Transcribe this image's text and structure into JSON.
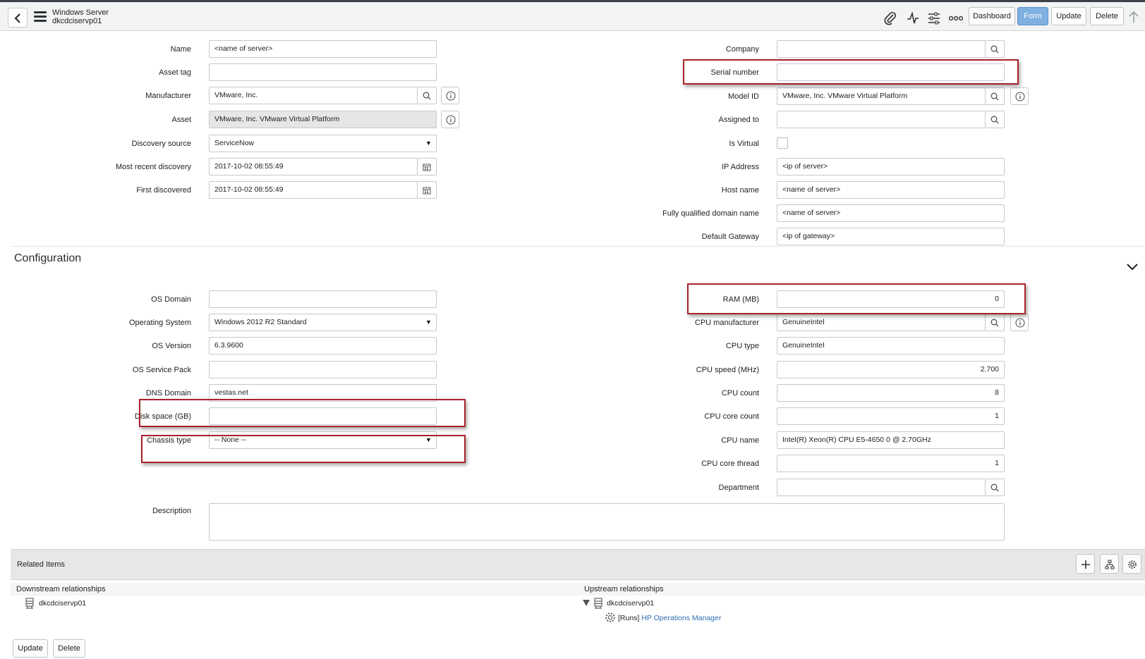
{
  "header": {
    "record_type": "Windows Server",
    "record_name": "dkcdciservp01",
    "buttons": {
      "dashboard": "Dashboard",
      "form": "Form",
      "update": "Update",
      "delete": "Delete"
    }
  },
  "form_left": {
    "name": {
      "label": "Name",
      "value": "<name of server>"
    },
    "asset_tag": {
      "label": "Asset tag",
      "value": ""
    },
    "manufacturer": {
      "label": "Manufacturer",
      "value": "VMware, Inc."
    },
    "asset": {
      "label": "Asset",
      "value": "VMware, Inc. VMware Virtual Platform"
    },
    "discovery_source": {
      "label": "Discovery source",
      "value": "ServiceNow"
    },
    "most_recent_discovery": {
      "label": "Most recent discovery",
      "value": "2017-10-02 08:55:49"
    },
    "first_discovered": {
      "label": "First discovered",
      "value": "2017-10-02 08:55:49"
    }
  },
  "form_right": {
    "company": {
      "label": "Company",
      "value": ""
    },
    "serial_number": {
      "label": "Serial number",
      "value": ""
    },
    "model_id": {
      "label": "Model ID",
      "value": "VMware, Inc. VMware Virtual Platform"
    },
    "assigned_to": {
      "label": "Assigned to",
      "value": ""
    },
    "is_virtual": {
      "label": "Is Virtual",
      "checked": false
    },
    "ip_address": {
      "label": "IP Address",
      "value": "<ip of server>"
    },
    "host_name": {
      "label": "Host name",
      "value": "<name of server>"
    },
    "fqdn": {
      "label": "Fully qualified domain name",
      "value": "<name of server>"
    },
    "default_gateway": {
      "label": "Default Gateway",
      "value": "<ip of gateway>"
    }
  },
  "configuration": {
    "title": "Configuration",
    "left": {
      "os_domain": {
        "label": "OS Domain",
        "value": ""
      },
      "operating_system": {
        "label": "Operating System",
        "value": "Windows 2012 R2 Standard"
      },
      "os_version": {
        "label": "OS Version",
        "value": "6.3.9600"
      },
      "os_service_pack": {
        "label": "OS Service Pack",
        "value": ""
      },
      "dns_domain": {
        "label": "DNS Domain",
        "value": "vestas.net"
      },
      "disk_space": {
        "label": "Disk space (GB)",
        "value": ""
      },
      "chassis_type": {
        "label": "Chassis type",
        "value": "-- None --"
      }
    },
    "right": {
      "ram": {
        "label": "RAM (MB)",
        "value": "0"
      },
      "cpu_manufacturer": {
        "label": "CPU manufacturer",
        "value": "GenuineIntel"
      },
      "cpu_type": {
        "label": "CPU type",
        "value": "GenuineIntel"
      },
      "cpu_speed": {
        "label": "CPU speed (MHz)",
        "value": "2.700"
      },
      "cpu_count": {
        "label": "CPU count",
        "value": "8"
      },
      "cpu_core_count": {
        "label": "CPU core count",
        "value": "1"
      },
      "cpu_name": {
        "label": "CPU name",
        "value": "Intel(R) Xeon(R) CPU E5-4650 0 @ 2.70GHz"
      },
      "cpu_core_thread": {
        "label": "CPU core thread",
        "value": "1"
      },
      "department": {
        "label": "Department",
        "value": ""
      }
    },
    "description": {
      "label": "Description",
      "value": ""
    }
  },
  "related": {
    "title": "Related Items",
    "downstream": {
      "heading": "Downstream relationships",
      "item": "dkcdciservp01"
    },
    "upstream": {
      "heading": "Upstream relationships",
      "item": "dkcdciservp01",
      "child_prefix": "[Runs]",
      "child_link": "HP Operations Manager"
    }
  },
  "footer": {
    "update": "Update",
    "delete": "Delete"
  },
  "colors": {
    "highlight": "#a8232a",
    "active_button": "#7fb0e0",
    "link": "#2f6eb5"
  },
  "icons": [
    "back-icon",
    "menu-icon",
    "paperclip-icon",
    "activity-icon",
    "sliders-icon",
    "more-icon",
    "up-arrow-icon",
    "search-icon",
    "info-icon",
    "calendar-icon",
    "chevron-down-icon",
    "plus-icon",
    "hierarchy-icon",
    "gear-icon",
    "server-icon"
  ]
}
